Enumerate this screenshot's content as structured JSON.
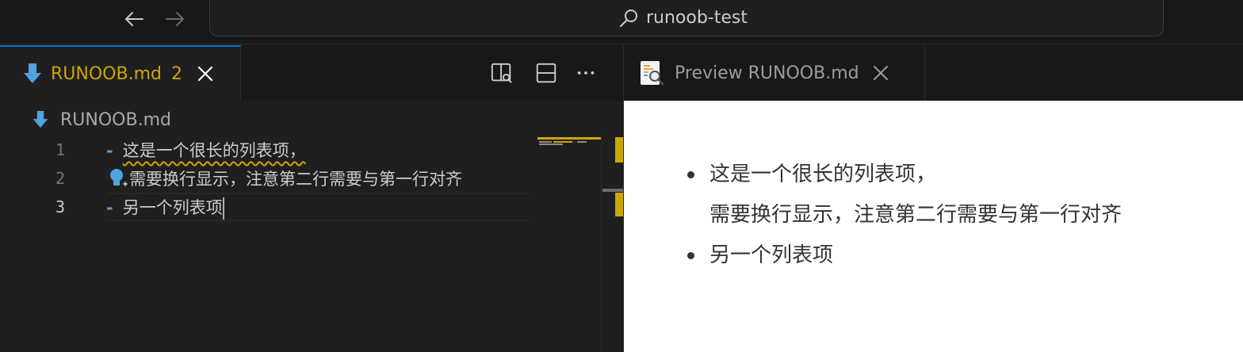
{
  "title_bar": {
    "search_text": "runoob-test"
  },
  "editor": {
    "tab": {
      "filename": "RUNOOB.md",
      "problem_count": "2"
    },
    "breadcrumb": "RUNOOB.md",
    "lines": [
      {
        "number": "1",
        "text": "这是一个很长的列表项，",
        "marker": "-"
      },
      {
        "number": "2",
        "text": "需要换行显示，注意第二行需要与第一行对齐",
        "marker": ""
      },
      {
        "number": "3",
        "text": "另一个列表项",
        "marker": "-"
      }
    ]
  },
  "preview": {
    "tab_title": "Preview RUNOOB.md",
    "items": [
      {
        "line1": "这是一个很长的列表项，",
        "line2": "需要换行显示，注意第二行需要与第一行对齐"
      },
      {
        "line1": "另一个列表项"
      }
    ]
  },
  "colors": {
    "accent": "#0078d4",
    "warning": "#cca700",
    "markdown_icon": "#4fa3e0"
  }
}
